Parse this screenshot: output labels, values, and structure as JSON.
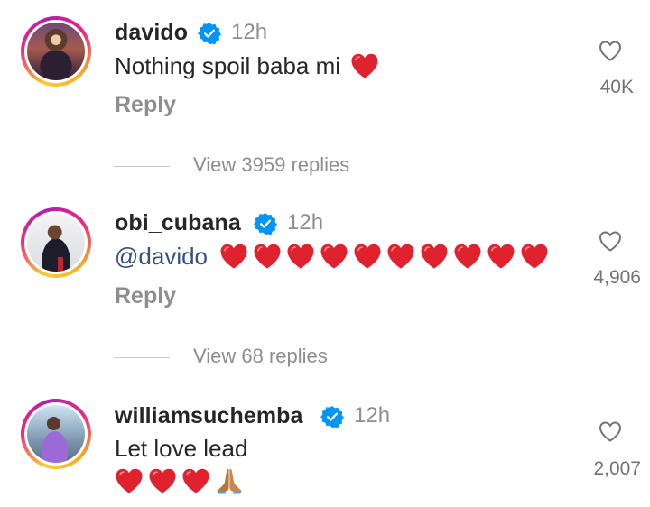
{
  "comments": [
    {
      "username": "davido",
      "verified": true,
      "time": "12h",
      "text": "Nothing spoil baba mi",
      "emoji": [
        "red-heart"
      ],
      "reply_label": "Reply",
      "like_count": "40K",
      "view_replies": "View 3959 replies"
    },
    {
      "username": "obi_cubana",
      "verified": true,
      "time": "12h",
      "mention": "@davido",
      "emoji": [
        "red-heart",
        "red-heart",
        "red-heart",
        "red-heart",
        "red-heart",
        "red-heart",
        "red-heart",
        "red-heart",
        "red-heart",
        "red-heart"
      ],
      "reply_label": "Reply",
      "like_count": "4,906",
      "view_replies": "View 68 replies"
    },
    {
      "username": "williamsuchemba",
      "verified": true,
      "time": "12h",
      "text": "Let love lead",
      "emoji": [
        "red-heart",
        "red-heart",
        "red-heart",
        "folded-hands"
      ],
      "like_count": "2,007"
    }
  ],
  "colors": {
    "text": "#262626",
    "secondary": "#8e8e8e",
    "verified": "#0095f6",
    "mention": "#385185",
    "heart_emoji": "#e0212e"
  },
  "icons": [
    "verified-badge-icon",
    "heart-outline-icon",
    "red-heart-emoji",
    "folded-hands-emoji"
  ]
}
